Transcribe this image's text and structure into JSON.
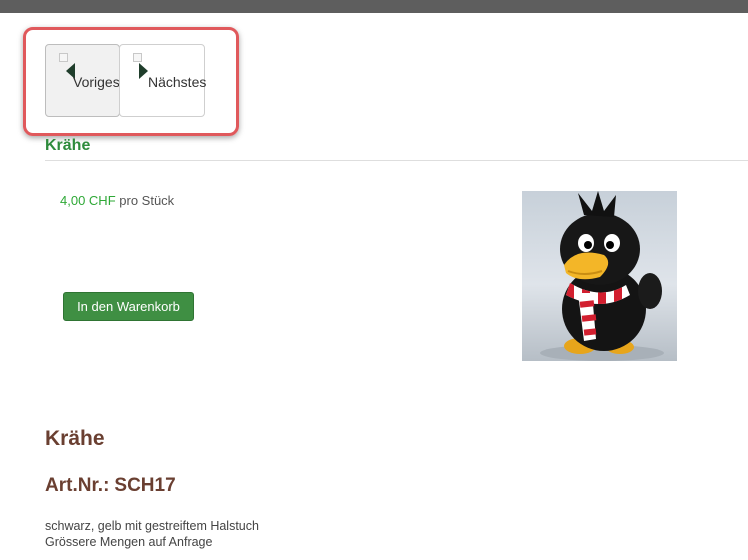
{
  "nav": {
    "prev_label": "Voriges",
    "next_label": "Nächstes"
  },
  "product": {
    "title": "Krähe",
    "price": "4,00 CHF",
    "unit": "pro Stück",
    "cart_button": "In den Warenkorb",
    "image_icon": "crow-plush-photo",
    "heading": "Krähe",
    "art_label": "Art.Nr.:",
    "art_number": "SCH17",
    "description_lines": [
      "schwarz, gelb mit gestreiftem Halstuch",
      "Grössere Mengen auf Anfrage"
    ]
  },
  "colors": {
    "highlight": "#e0595c",
    "title_green": "#2e8b3c",
    "price_green": "#2ea836",
    "button_green": "#3f8f43",
    "heading_brown": "#6a3f31"
  }
}
